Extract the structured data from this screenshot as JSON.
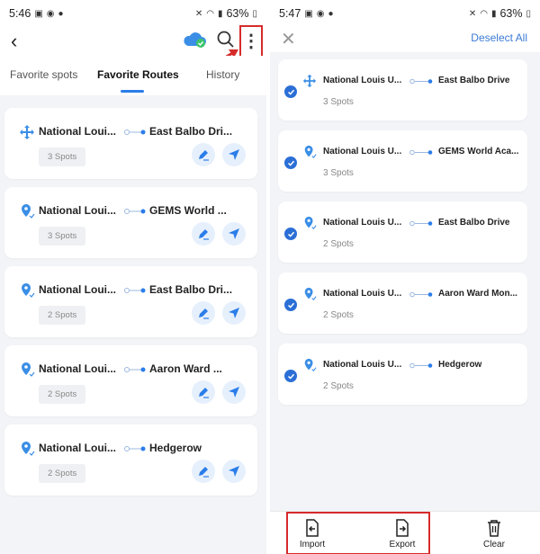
{
  "left": {
    "status": {
      "time": "5:46",
      "battery": "63%"
    },
    "tabs": [
      {
        "label": "Favorite spots"
      },
      {
        "label": "Favorite Routes"
      },
      {
        "label": "History"
      }
    ],
    "routes": [
      {
        "from": "National Loui...",
        "to": "East Balbo Dri...",
        "spots": "3 Spots",
        "icon": "route-multi-icon"
      },
      {
        "from": "National Loui...",
        "to": "GEMS World ...",
        "spots": "3 Spots",
        "icon": "pin-route-icon"
      },
      {
        "from": "National Loui...",
        "to": "East Balbo Dri...",
        "spots": "2 Spots",
        "icon": "pin-route-icon"
      },
      {
        "from": "National Loui...",
        "to": "Aaron Ward ...",
        "spots": "2 Spots",
        "icon": "pin-route-icon"
      },
      {
        "from": "National Loui...",
        "to": "Hedgerow",
        "spots": "2 Spots",
        "icon": "pin-route-icon"
      }
    ]
  },
  "right": {
    "status": {
      "time": "5:47",
      "battery": "63%"
    },
    "deselect_label": "Deselect All",
    "routes": [
      {
        "from": "National Louis U...",
        "to": "East Balbo Drive",
        "spots": "3 Spots",
        "icon": "route-multi-icon"
      },
      {
        "from": "National Louis U...",
        "to": "GEMS World Aca...",
        "spots": "3 Spots",
        "icon": "pin-route-icon"
      },
      {
        "from": "National Louis U...",
        "to": "East Balbo Drive",
        "spots": "2 Spots",
        "icon": "pin-route-icon"
      },
      {
        "from": "National Louis U...",
        "to": "Aaron Ward Mon...",
        "spots": "2 Spots",
        "icon": "pin-route-icon"
      },
      {
        "from": "National Louis U...",
        "to": "Hedgerow",
        "spots": "2 Spots",
        "icon": "pin-route-icon"
      }
    ],
    "bottom": {
      "import_label": "Import",
      "export_label": "Export",
      "clear_label": "Clear"
    }
  },
  "colors": {
    "accent": "#2b7de9",
    "highlight": "#d62b2b",
    "check": "#2b6fd6"
  }
}
